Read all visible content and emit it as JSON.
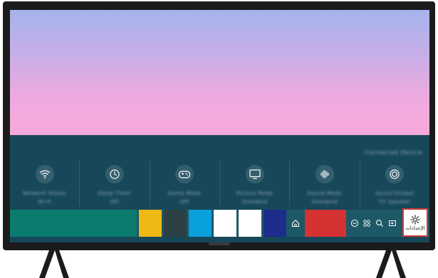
{
  "panel": {
    "title": "Connected Device",
    "quick_settings": [
      {
        "icon": "wifi-icon",
        "label1": "Network Status",
        "label2": "Wi-Fi"
      },
      {
        "icon": "clock-icon",
        "label1": "Sleep Timer",
        "label2": "Off"
      },
      {
        "icon": "gamepad-icon",
        "label1": "Game Mode",
        "label2": "Off"
      },
      {
        "icon": "tv-icon",
        "label1": "Picture Mode",
        "label2": "Standard"
      },
      {
        "icon": "sound-wave-icon",
        "label1": "Sound Mode",
        "label2": "Standard"
      },
      {
        "icon": "output-icon",
        "label1": "Sound Output",
        "label2": "TV Speaker"
      }
    ]
  },
  "launcher": {
    "tile_colors": [
      "#f0b812",
      "#2d4043",
      "#0aa0de",
      "#ffffff",
      "#ffffff",
      "#1e2c8c"
    ],
    "settings_label": "الإعدادات"
  },
  "colors": {
    "panel": "#17485a",
    "app_bar": "#0a7c6d",
    "red_tile": "#d53234",
    "highlight": "#d33a3a"
  }
}
